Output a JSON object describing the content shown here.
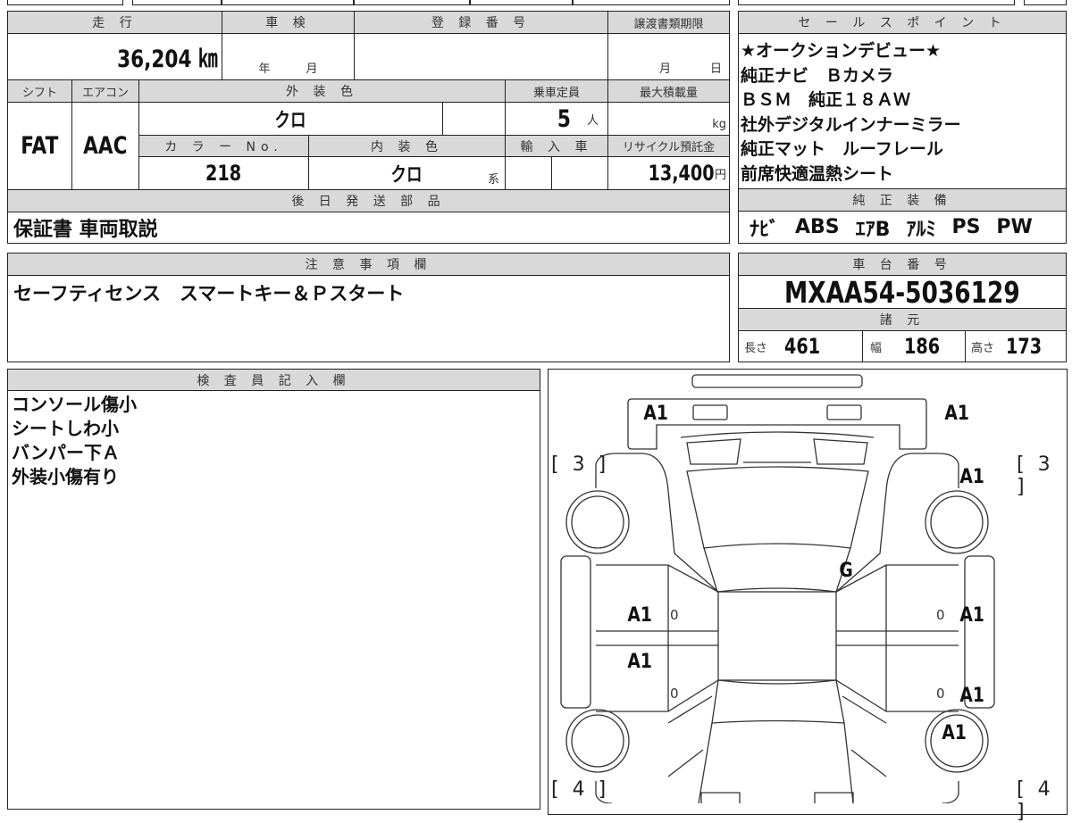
{
  "top_table": {
    "mileage_label": "走 行",
    "mileage": "36,204 ㎞",
    "shaken_label": "車 検",
    "shaken_year": "年",
    "shaken_month": "月",
    "reg_label": "登 録 番 号",
    "transfer_label": "譲渡書類期限",
    "transfer_month": "月",
    "transfer_day": "日",
    "shift_label": "シフト",
    "shift": "FAT",
    "ac_label": "エアコン",
    "ac": "AAC",
    "ext_color_label": "外 装 色",
    "ext_color": "クロ",
    "capacity_label": "乗車定員",
    "capacity": "5",
    "capacity_unit": "人",
    "max_load_label": "最大積載量",
    "max_load_unit": "kg",
    "color_no_label": "カ ラ ー No.",
    "color_no": "218",
    "int_color_label": "内 装 色",
    "int_color": "クロ",
    "int_color_suffix": "系",
    "import_label": "輸 入 車",
    "recycle_label": "リサイクル預託金",
    "recycle": "13,400",
    "recycle_unit": "円",
    "later_parts_label": "後 日 発 送 部 品",
    "later_parts": "保証書 車両取説"
  },
  "sales_points": {
    "label": "セ ー ル ス ポ イ ン ト",
    "lines": [
      "★オークションデビュー★",
      "純正ナビ　Ｂカメラ",
      "ＢＳＭ　純正１８ＡＷ",
      "社外デジタルインナーミラー",
      "純正マット　ルーフレール",
      "前席快適温熱シート"
    ]
  },
  "equipment": {
    "label": "純 正 装 備",
    "items": [
      "ﾅﾋﾞ",
      "ABS",
      "ｴｱB",
      "ｱﾙﾐ",
      "PS",
      "PW"
    ]
  },
  "notes": {
    "label": "注 意 事 項 欄",
    "text": "セーフティセンス　スマートキー＆Ｐスタート"
  },
  "chassis": {
    "label": "車 台 番 号",
    "number": "MXAA54-5036129"
  },
  "specs": {
    "label": "諸 元",
    "length_label": "長さ",
    "length": "461",
    "width_label": "幅",
    "width": "186",
    "height_label": "高さ",
    "height": "173"
  },
  "inspector": {
    "label": "検 査 員 記 入 欄",
    "lines": [
      "コンソール傷小",
      "シートしわ小",
      "バンパー下Ａ",
      "外装小傷有り"
    ]
  },
  "diagram": {
    "marks": [
      "A1",
      "A1",
      "A1",
      "G",
      "A1",
      "A1",
      "A1",
      "A1",
      "A1"
    ],
    "zeros": [
      "0",
      "0",
      "0",
      "0"
    ],
    "brackets": [
      "[ 3 ]",
      "[ 3 ]",
      "[ 4 ]",
      "[ 4 ]"
    ]
  }
}
